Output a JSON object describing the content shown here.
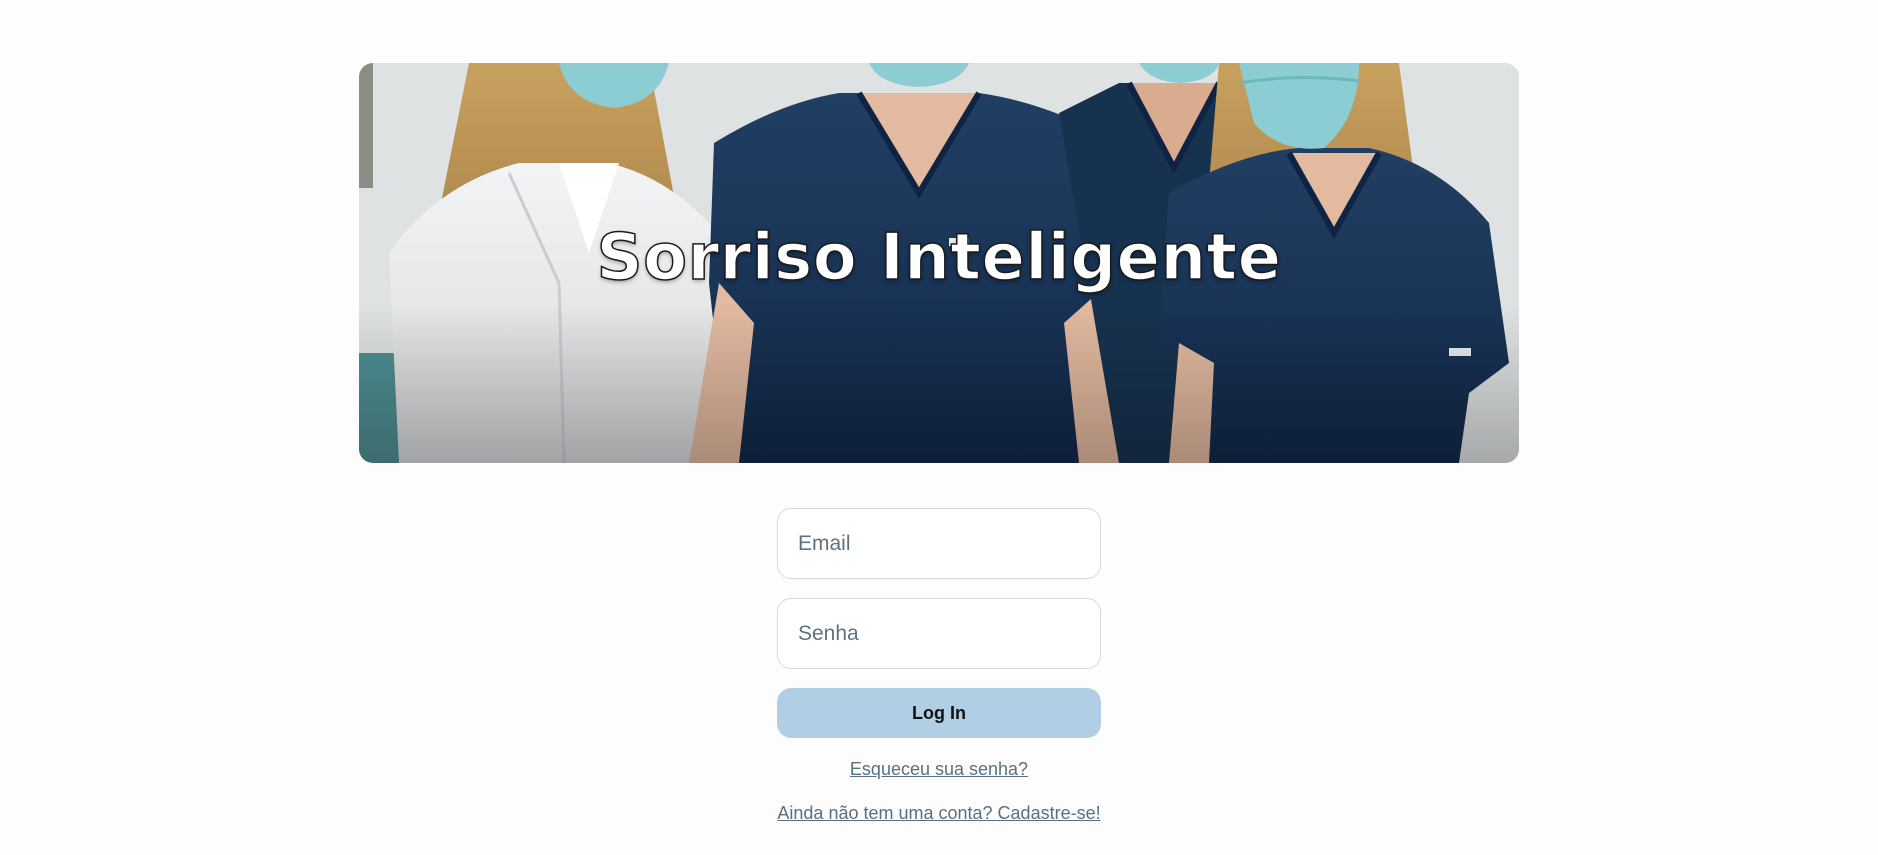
{
  "hero": {
    "title": "Sorriso Inteligente"
  },
  "login_form": {
    "email_placeholder": "Email",
    "email_value": "",
    "password_placeholder": "Senha",
    "password_value": "",
    "login_button_label": "Log In",
    "forgot_password_link": "Esqueceu sua senha?",
    "signup_link": "Ainda não tem uma conta? Cadastre-se!"
  },
  "colors": {
    "page_background": "#fdfdfd",
    "button_background": "#b0cfe4",
    "link_color": "#587082",
    "scrub_navy": "#1b3a5e",
    "mask_teal": "#8ccdd3"
  }
}
